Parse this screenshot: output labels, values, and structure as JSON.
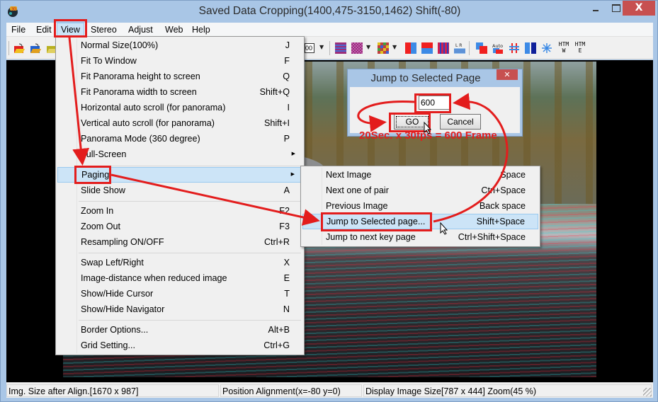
{
  "window": {
    "title": "Saved Data Cropping(1400,475-3150,1462) Shift(-80)",
    "controls": {
      "minimize": "–",
      "maximize": "□",
      "close": "X"
    }
  },
  "menubar": {
    "items": [
      {
        "label": "File"
      },
      {
        "label": "Edit"
      },
      {
        "label": "View",
        "active": true
      },
      {
        "label": "Stereo"
      },
      {
        "label": "Adjust"
      },
      {
        "label": "Web"
      },
      {
        "label": "Help"
      }
    ]
  },
  "toolbar": {
    "icons": [
      "open-folder-red-icon",
      "open-folder-blue-icon",
      "open-folder-yellow-icon",
      "zoom-100-icon",
      "line-interlace-icon",
      "checker-icon",
      "color-mosaic-icon",
      "side-by-side-icon",
      "top-bottom-icon",
      "column-interlace-icon",
      "grid-lines-icon",
      "overlay-icon",
      "auto-align-icon",
      "crosshair-icon",
      "blue-pair-icon",
      "snowflake-icon",
      "htm-w-icon",
      "htm-e-icon"
    ],
    "htm_w_label": "HTM W",
    "htm_e_label": "HTM E",
    "auto_label": "Auto",
    "zoom_label": "00"
  },
  "view_menu": {
    "items": [
      {
        "label": "Normal Size(100%)",
        "shortcut": "J"
      },
      {
        "label": "Fit To Window",
        "shortcut": "F"
      },
      {
        "label": "Fit Panorama height to screen",
        "shortcut": "Q"
      },
      {
        "label": "Fit Panorama width to screen",
        "shortcut": "Shift+Q"
      },
      {
        "label": "Horizontal auto scroll (for panorama)",
        "shortcut": "I"
      },
      {
        "label": "Vertical auto scroll (for panorama)",
        "shortcut": "Shift+I"
      },
      {
        "label": "Panorama Mode (360 degree)",
        "shortcut": "P"
      },
      {
        "label": "Full-Screen",
        "shortcut": "",
        "submenu": true
      },
      {
        "label": "Paging",
        "shortcut": "",
        "submenu": true,
        "highlighted": true
      },
      {
        "label": "Slide Show",
        "shortcut": "A"
      },
      {
        "label": "Zoom In",
        "shortcut": "F2"
      },
      {
        "label": "Zoom Out",
        "shortcut": "F3"
      },
      {
        "label": "Resampling ON/OFF",
        "shortcut": "Ctrl+R"
      },
      {
        "label": "Swap Left/Right",
        "shortcut": "X"
      },
      {
        "label": "Image-distance when reduced image",
        "shortcut": "E"
      },
      {
        "label": "Show/Hide Cursor",
        "shortcut": "T"
      },
      {
        "label": "Show/Hide Navigator",
        "shortcut": "N"
      },
      {
        "label": "Border Options...",
        "shortcut": "Alt+B"
      },
      {
        "label": "Grid Setting...",
        "shortcut": "Ctrl+G"
      }
    ]
  },
  "paging_menu": {
    "items": [
      {
        "label": "Next Image",
        "shortcut": "Space"
      },
      {
        "label": "Next one of pair",
        "shortcut": "Ctrl+Space"
      },
      {
        "label": "Previous Image",
        "shortcut": "Back space"
      },
      {
        "label": "Jump to Selected page...",
        "shortcut": "Shift+Space",
        "highlighted": true
      },
      {
        "label": "Jump to next key page",
        "shortcut": "Ctrl+Shift+Space"
      }
    ]
  },
  "dialog": {
    "title": "Jump to Selected Page",
    "close": "✕",
    "page_value": "600",
    "go_label": "GO",
    "cancel_label": "Cancel"
  },
  "annotation": {
    "text": "20Sec. x 30fps = 600 Frame",
    "color": "#e31d1d"
  },
  "statusbar": {
    "img_size": "Img. Size after Align.[1670 x 987]",
    "position_alignment": "Position Alignment(x=-80 y=0)",
    "display_size": "Display Image Size[787 x 444]  Zoom(45 %)"
  },
  "colors": {
    "frame": "#a9c6e6",
    "close_button": "#c75050",
    "menu_highlight": "#cce4f7",
    "annotation_red": "#e31d1d"
  }
}
